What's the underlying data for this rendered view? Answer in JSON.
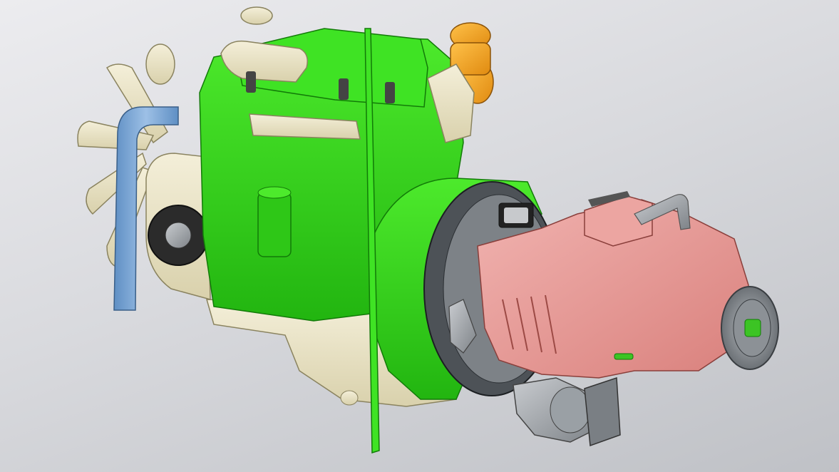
{
  "viewport": {
    "background_top": "#ececef",
    "background_bottom": "#bfc1c6"
  },
  "model": {
    "components": [
      {
        "name": "cooling-fan",
        "color": "#efe9cf"
      },
      {
        "name": "radiator-hose",
        "color": "#7aa6d3"
      },
      {
        "name": "engine-block",
        "color": "#37d61d"
      },
      {
        "name": "oil-pan",
        "color": "#efe9cf"
      },
      {
        "name": "turbocharger",
        "color": "#f0a020"
      },
      {
        "name": "transmission-housing",
        "color": "#e8a0a0"
      },
      {
        "name": "output-flange",
        "color": "#a0a4a8"
      },
      {
        "name": "starter-motor",
        "color": "#a0a4a8"
      }
    ]
  }
}
